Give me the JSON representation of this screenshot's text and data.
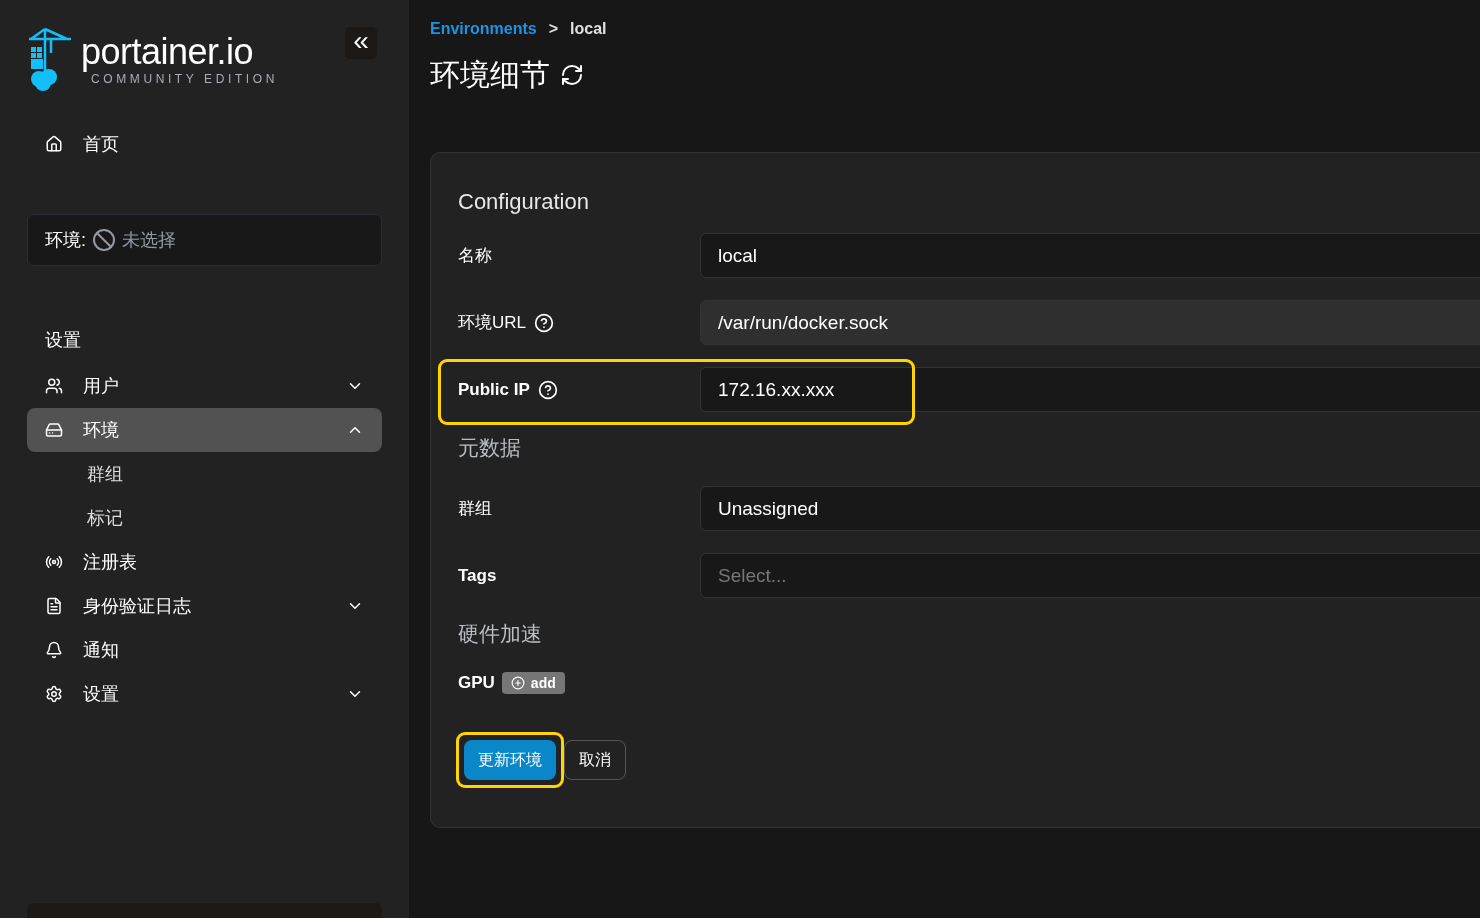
{
  "logo": {
    "name": "portainer.io",
    "edition": "COMMUNITY EDITION"
  },
  "collapse_button": {
    "label": "«"
  },
  "sidebar": {
    "home": {
      "label": "首页"
    },
    "environment_selector": {
      "label": "环境:",
      "value": "未选择"
    },
    "section_title": "设置",
    "items": [
      {
        "label": "用户",
        "expanded": false,
        "selected": false
      },
      {
        "label": "环境",
        "expanded": true,
        "selected": true,
        "children": [
          {
            "label": "群组",
            "selected": false
          },
          {
            "label": "标记",
            "selected": false
          }
        ]
      },
      {
        "label": "注册表",
        "selected": false
      },
      {
        "label": "身份验证日志",
        "expanded": false,
        "selected": false
      },
      {
        "label": "通知",
        "selected": false
      },
      {
        "label": "设置",
        "expanded": false,
        "selected": false
      }
    ]
  },
  "breadcrumb": [
    {
      "label": "Environments",
      "kind": "link"
    },
    {
      "label": ">",
      "kind": "separator"
    },
    {
      "label": "local",
      "kind": "current"
    }
  ],
  "page_title": "环境细节",
  "form": {
    "sections": [
      {
        "title": "Configuration",
        "kind": "primary",
        "rows": [
          {
            "label": "名称",
            "help": false,
            "value": "local",
            "disabled": false,
            "highlighted": false
          },
          {
            "label": "环境URL",
            "help": true,
            "value": "/var/run/docker.sock",
            "disabled": true,
            "highlighted": false
          },
          {
            "label": "Public IP",
            "help": true,
            "value": "172.16.xx.xxx",
            "disabled": false,
            "highlighted": true
          }
        ]
      },
      {
        "title": "元数据",
        "kind": "secondary",
        "rows": [
          {
            "label": "群组",
            "help": false,
            "value": "Unassigned",
            "disabled": false,
            "highlighted": false
          },
          {
            "label": "Tags",
            "help": false,
            "placeholder": "Select...",
            "disabled": false,
            "highlighted": false
          }
        ]
      },
      {
        "title": "硬件加速",
        "kind": "secondary"
      }
    ],
    "gpu": {
      "label": "GPU",
      "button": "add"
    },
    "buttons": [
      {
        "label": "更新环境",
        "kind": "primary",
        "highlighted": true
      },
      {
        "label": "取消",
        "kind": "secondary",
        "highlighted": false
      }
    ]
  }
}
